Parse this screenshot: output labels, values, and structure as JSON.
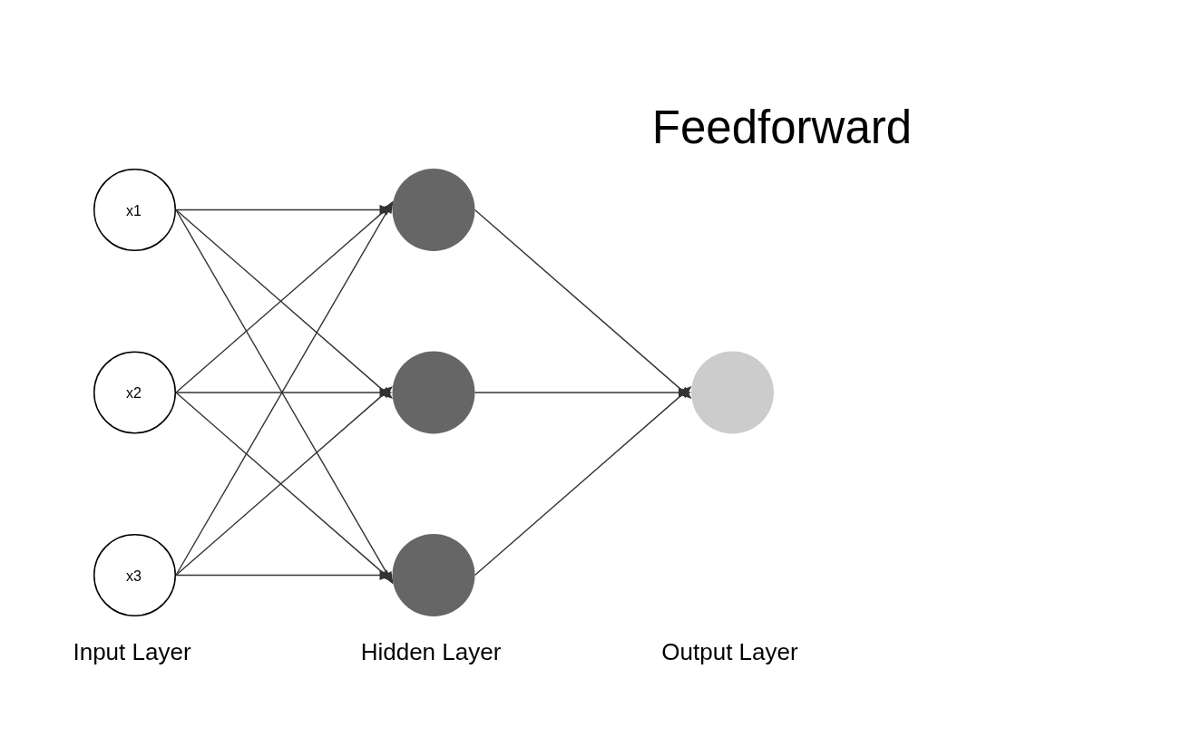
{
  "title": "Feedforward",
  "layers": [
    {
      "label": "Input Layer",
      "kind": "outlined",
      "nodes": [
        {
          "label": "x1"
        },
        {
          "label": "x2"
        },
        {
          "label": "x3"
        }
      ]
    },
    {
      "label": "Hidden Layer",
      "kind": "filled",
      "nodes": [
        {
          "color": "#666666"
        },
        {
          "color": "#666666"
        },
        {
          "color": "#666666"
        }
      ]
    },
    {
      "label": "Output Layer",
      "kind": "filled",
      "nodes": [
        {
          "color": "#cccccc"
        }
      ]
    }
  ]
}
